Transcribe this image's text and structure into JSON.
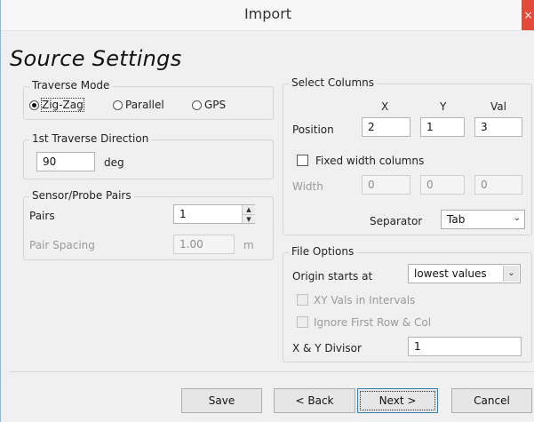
{
  "window": {
    "title": "Import",
    "close_glyph": "×"
  },
  "heading": "Source Settings",
  "traverse_mode": {
    "label": "Traverse Mode",
    "options": [
      "Zig-Zag",
      "Parallel",
      "GPS"
    ],
    "selected": "Zig-Zag"
  },
  "first_direction": {
    "label": "1st Traverse Direction",
    "value": "90",
    "unit": "deg"
  },
  "sensor_pairs": {
    "label": "Sensor/Probe Pairs",
    "pairs_label": "Pairs",
    "pairs_value": "1",
    "spacing_label": "Pair Spacing",
    "spacing_value": "1.00",
    "spacing_unit": "m"
  },
  "select_columns": {
    "label": "Select Columns",
    "col_headers": [
      "X",
      "Y",
      "Val"
    ],
    "position_label": "Position",
    "position_values": [
      "2",
      "1",
      "3"
    ],
    "fixed_width_label": "Fixed width columns",
    "fixed_width_checked": false,
    "width_label": "Width",
    "width_values": [
      "0",
      "0",
      "0"
    ],
    "separator_label": "Separator",
    "separator_value": "Tab"
  },
  "file_options": {
    "label": "File Options",
    "origin_label": "Origin starts at",
    "origin_value": "lowest values",
    "xy_intervals_label": "XY Vals in Intervals",
    "ignore_first_label": "Ignore First Row & Col",
    "divisor_label": "X & Y Divisor",
    "divisor_value": "1"
  },
  "buttons": {
    "save": "Save",
    "back": "< Back",
    "next": "Next >",
    "cancel": "Cancel"
  }
}
